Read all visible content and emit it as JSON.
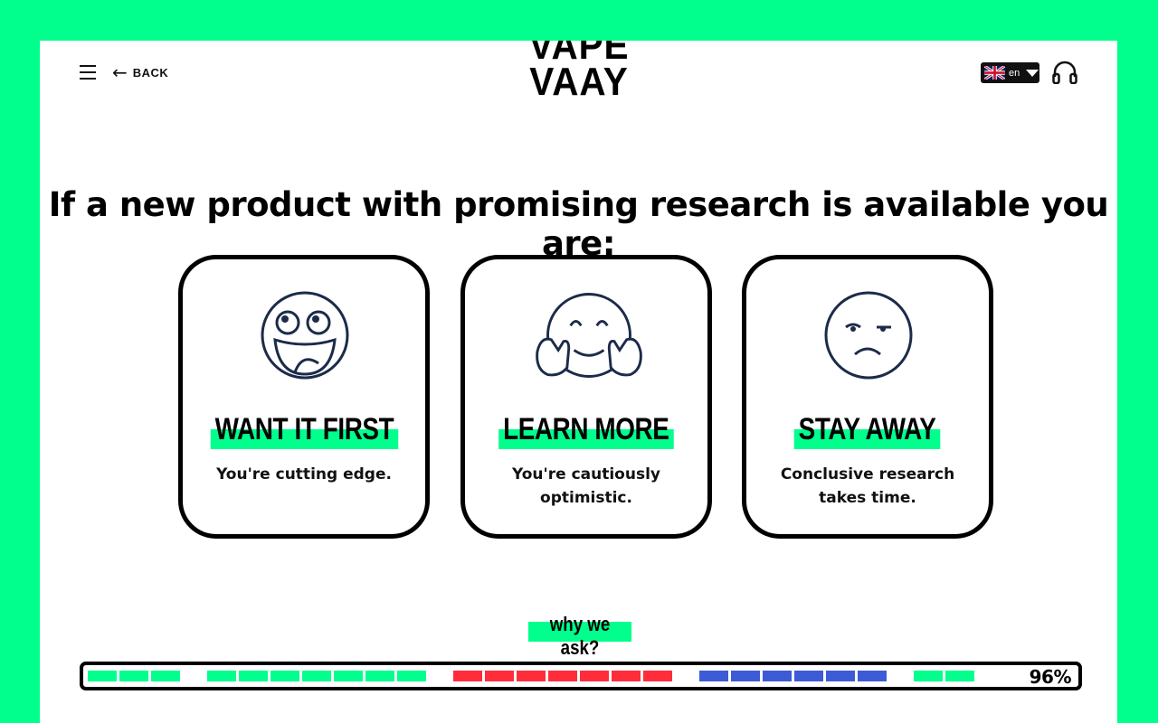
{
  "header": {
    "back_label": "BACK",
    "logo_line1": "VAPE",
    "logo_line2": "VAAY",
    "language_code": "en"
  },
  "question": "If a new product with promising research is available you are:",
  "options": [
    {
      "icon": "grinning-face-icon",
      "title": "WANT IT FIRST",
      "description": "You're cutting edge."
    },
    {
      "icon": "hugging-face-icon",
      "title": "LEARN MORE",
      "description": "You're cautiously optimistic."
    },
    {
      "icon": "skeptical-face-icon",
      "title": "STAY AWAY",
      "description": "Conclusive research takes time."
    }
  ],
  "why_label": "why we ask?",
  "progress": {
    "percent_label": "96%",
    "percent_value": 0.96,
    "groups": [
      {
        "color": "#00ff8c",
        "count": 3
      },
      {
        "color": "#00ff8c",
        "count": 7
      },
      {
        "color": "#ff2d3b",
        "count": 7
      },
      {
        "color": "#3d5bd6",
        "count": 6
      },
      {
        "color": "#00ff8c",
        "count": 2
      }
    ]
  },
  "colors": {
    "accent_green": "#00ff8c",
    "progress_red": "#ff2d3b",
    "progress_blue": "#3d5bd6",
    "icon_navy": "#1c2b4a"
  }
}
